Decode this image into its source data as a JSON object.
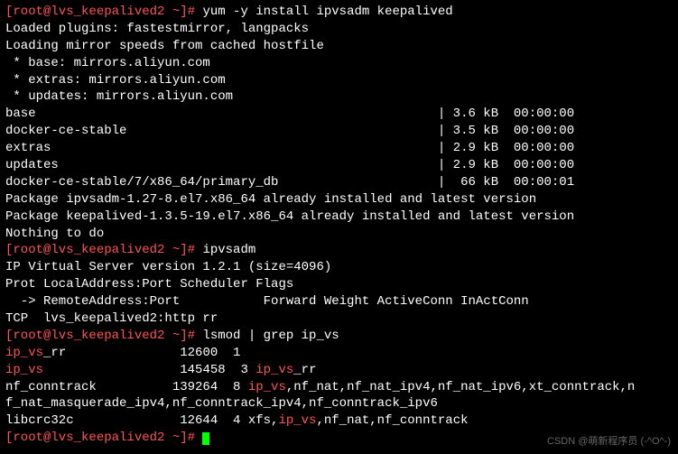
{
  "prompt1": "[root@lvs_keepalived2 ~]# ",
  "cmd1": "yum -y install ipvsadm keepalived",
  "l1": "Loaded plugins: fastestmirror, langpacks",
  "l2": "Loading mirror speeds from cached hostfile",
  "l3": " * base: mirrors.aliyun.com",
  "l4": " * extras: mirrors.aliyun.com",
  "l5": " * updates: mirrors.aliyun.com",
  "repo1_name": "base",
  "repo1_pad": "                                                     | 3.6 kB  00:00:00",
  "repo2_name": "docker-ce-stable",
  "repo2_pad": "                                         | 3.5 kB  00:00:00",
  "repo3_name": "extras",
  "repo3_pad": "                                                   | 2.9 kB  00:00:00",
  "repo4_name": "updates",
  "repo4_pad": "                                                  | 2.9 kB  00:00:00",
  "repo5_name": "docker-ce-stable/7/x86_64/primary_db",
  "repo5_pad": "                     |  66 kB  00:00:01",
  "pkg1": "Package ipvsadm-1.27-8.el7.x86_64 already installed and latest version",
  "pkg2": "Package keepalived-1.3.5-19.el7.x86_64 already installed and latest version",
  "nothing": "Nothing to do",
  "cmd2": "ipvsadm",
  "ipvs1": "IP Virtual Server version 1.2.1 (size=4096)",
  "ipvs2": "Prot LocalAddress:Port Scheduler Flags",
  "ipvs3": "  -> RemoteAddress:Port           Forward Weight ActiveConn InActConn",
  "ipvs4": "TCP  lvs_keepalived2:http rr",
  "cmd3": "lsmod | grep ip_vs",
  "mod1a": "ip_vs",
  "mod1b": "_rr               12600  1",
  "mod2a": "ip_vs",
  "mod2b": "                  145458  3 ",
  "mod2c": "ip_vs",
  "mod2d": "_rr",
  "mod3a": "nf_conntrack          139264  8 ",
  "mod3b": "ip_vs",
  "mod3c": ",nf_nat,nf_nat_ipv4,nf_nat_ipv6,xt_conntrack,n",
  "mod4": "f_nat_masquerade_ipv4,nf_conntrack_ipv4,nf_conntrack_ipv6",
  "mod5a": "libcrc32c              12644  4 xfs,",
  "mod5b": "ip_vs",
  "mod5c": ",nf_nat,nf_conntrack",
  "watermark": "CSDN @萌新程序员 (-^O^-)"
}
